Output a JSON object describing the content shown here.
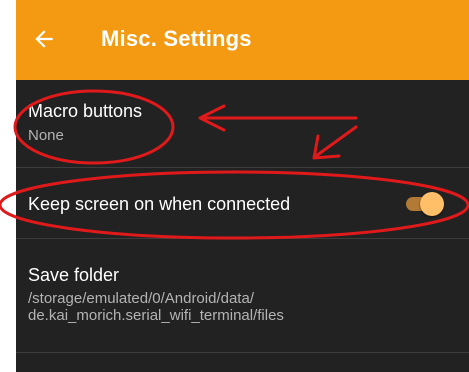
{
  "appbar": {
    "title": "Misc. Settings",
    "back_icon": "arrow-left-icon",
    "color": "#F49A12"
  },
  "preferences": [
    {
      "title": "Macro buttons",
      "summary": "None"
    },
    {
      "title": "Keep screen on when connected",
      "switch_on": true
    },
    {
      "title": "Save folder",
      "summary": "/storage/emulated/0/Android/data/\nde.kai_morich.serial_wifi_terminal/files"
    }
  ],
  "colors": {
    "background": "#222222",
    "accent": "#FFBE67",
    "annotation": "#E0191B"
  }
}
